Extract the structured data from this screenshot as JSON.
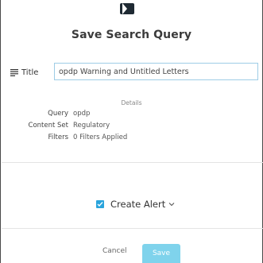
{
  "dialog": {
    "title": "Save Search Query",
    "icon": "bookmark-icon"
  },
  "title_field": {
    "label": "Title",
    "icon": "list-lines-icon",
    "value": "opdp Warning and Untitled Letters"
  },
  "details": {
    "heading": "Details",
    "rows": [
      {
        "key": "Query",
        "value": "opdp"
      },
      {
        "key": "Content Set",
        "value": "Regulatory"
      },
      {
        "key": "Filters",
        "value": "0 Filters Applied"
      }
    ]
  },
  "alert": {
    "label": "Create Alert",
    "checked": true,
    "icon": "chevron-down-icon"
  },
  "footer": {
    "cancel_label": "Cancel",
    "save_label": "Save"
  },
  "colors": {
    "accent": "#2aa4dc",
    "save_button": "#7fd3ec",
    "input_border": "#9ecde6"
  }
}
